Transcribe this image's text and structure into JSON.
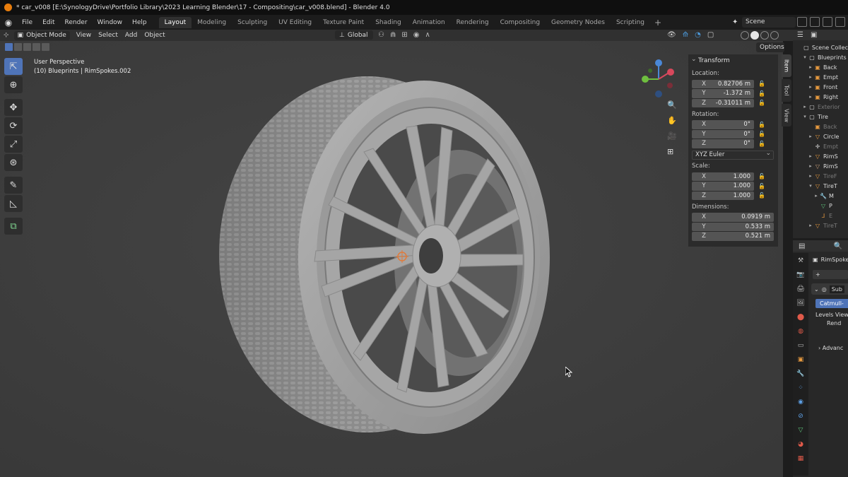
{
  "window": {
    "title": "* car_v008 [E:\\SynologyDrive\\Portfolio Library\\2023 Learning Blender\\17 - Compositing\\car_v008.blend] - Blender 4.0"
  },
  "menu": [
    "File",
    "Edit",
    "Render",
    "Window",
    "Help"
  ],
  "workspaces": {
    "active": "Layout",
    "tabs": [
      "Layout",
      "Modeling",
      "Sculpting",
      "UV Editing",
      "Texture Paint",
      "Shading",
      "Animation",
      "Rendering",
      "Compositing",
      "Geometry Nodes",
      "Scripting"
    ],
    "add": "+"
  },
  "scene": {
    "name": "Scene"
  },
  "viewport_header": {
    "mode": "Object Mode",
    "menus": [
      "View",
      "Select",
      "Add",
      "Object"
    ],
    "orientation": "Global"
  },
  "options_label": "Options",
  "viewport": {
    "perspective": "User Perspective",
    "object_info": "(10) Blueprints | RimSpokes.002"
  },
  "transform": {
    "header": "Transform",
    "location_label": "Location:",
    "location": [
      [
        "X",
        "0.82706 m"
      ],
      [
        "Y",
        "-1.372 m"
      ],
      [
        "Z",
        "-0.31011 m"
      ]
    ],
    "rotation_label": "Rotation:",
    "rotation": [
      [
        "X",
        "0°"
      ],
      [
        "Y",
        "0°"
      ],
      [
        "Z",
        "0°"
      ]
    ],
    "rotation_mode": "XYZ Euler",
    "scale_label": "Scale:",
    "scale": [
      [
        "X",
        "1.000"
      ],
      [
        "Y",
        "1.000"
      ],
      [
        "Z",
        "1.000"
      ]
    ],
    "dimensions_label": "Dimensions:",
    "dimensions": [
      [
        "X",
        "0.0919 m"
      ],
      [
        "Y",
        "0.533 m"
      ],
      [
        "Z",
        "0.521 m"
      ]
    ]
  },
  "sidetabs": [
    "Item",
    "Tool",
    "View"
  ],
  "outliner": {
    "items": [
      {
        "text": "Scene Collec",
        "tri": "",
        "icon": "▢",
        "color": "white",
        "indent": 0,
        "dim": false
      },
      {
        "text": "Blueprints",
        "tri": "▾",
        "icon": "▢",
        "color": "white",
        "indent": 1,
        "dim": false
      },
      {
        "text": "Back",
        "tri": "▸",
        "icon": "▣",
        "color": "orange",
        "indent": 2,
        "dim": false
      },
      {
        "text": "Empt",
        "tri": "▸",
        "icon": "▣",
        "color": "orange",
        "indent": 2,
        "dim": false
      },
      {
        "text": "Front",
        "tri": "▸",
        "icon": "▣",
        "color": "orange",
        "indent": 2,
        "dim": false
      },
      {
        "text": "Right",
        "tri": "▸",
        "icon": "▣",
        "color": "orange",
        "indent": 2,
        "dim": false
      },
      {
        "text": "Exterior",
        "tri": "▸",
        "icon": "▢",
        "color": "white",
        "indent": 1,
        "dim": true
      },
      {
        "text": "Tire",
        "tri": "▾",
        "icon": "▢",
        "color": "white",
        "indent": 1,
        "dim": false
      },
      {
        "text": "Back",
        "tri": "",
        "icon": "▣",
        "color": "orange",
        "indent": 2,
        "dim": true
      },
      {
        "text": "Circle",
        "tri": "▸",
        "icon": "▽",
        "color": "orange",
        "indent": 2,
        "dim": false
      },
      {
        "text": "Empt",
        "tri": "",
        "icon": "✛",
        "color": "white",
        "indent": 2,
        "dim": true
      },
      {
        "text": "RimS",
        "tri": "▸",
        "icon": "▽",
        "color": "orange",
        "indent": 2,
        "dim": false
      },
      {
        "text": "RimS",
        "tri": "▸",
        "icon": "▽",
        "color": "tan",
        "indent": 2,
        "dim": false
      },
      {
        "text": "TireF",
        "tri": "▸",
        "icon": "▽",
        "color": "orange",
        "indent": 2,
        "dim": true
      },
      {
        "text": "TireT",
        "tri": "▾",
        "icon": "▽",
        "color": "orange",
        "indent": 2,
        "dim": false
      },
      {
        "text": "M",
        "tri": "▸",
        "icon": "🔧",
        "color": "blue",
        "indent": 3,
        "dim": false
      },
      {
        "text": "P",
        "tri": "",
        "icon": "▽",
        "color": "green",
        "indent": 3,
        "dim": false
      },
      {
        "text": "E",
        "tri": "",
        "icon": "⅃",
        "color": "orange",
        "indent": 3,
        "dim": true
      },
      {
        "text": "TireT",
        "tri": "▸",
        "icon": "▽",
        "color": "orange",
        "indent": 2,
        "dim": true
      }
    ]
  },
  "properties": {
    "object_name": "RimSpoke",
    "add_label": "+",
    "modifier_name": "Sub",
    "subdiv_type": "Catmull-",
    "levels_label": "Levels View",
    "render_label": "Rend",
    "advanced_label": "Advanc"
  }
}
